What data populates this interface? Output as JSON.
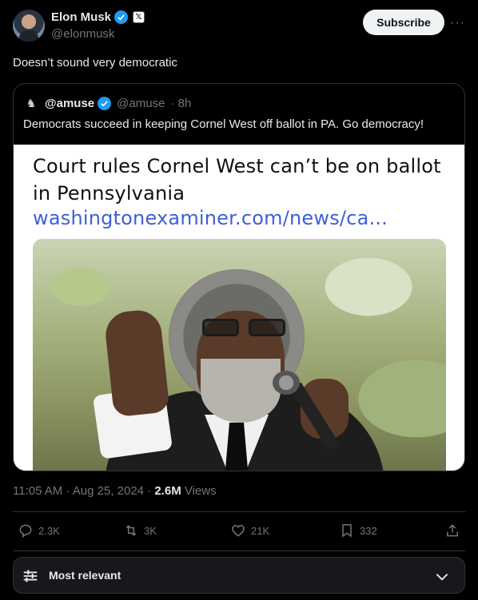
{
  "author": {
    "name": "Elon Musk",
    "handle": "@elonmusk",
    "badge": "𝕏"
  },
  "subscribe_label": "Subscribe",
  "more_label": "···",
  "tweet_text": "Doesn’t sound very democratic",
  "quote": {
    "name": "@amuse",
    "handle": "@amuse",
    "time": "· 8h",
    "text": "Democrats succeed in keeping Cornel West off ballot in PA. Go democracy!",
    "card": {
      "title": "Court rules Cornel West can’t be on ballot in Pennsylvania",
      "link": "washingtonexaminer.com/news/ca..."
    }
  },
  "meta": {
    "time": "11:05 AM · Aug 25, 2024 · ",
    "views_count": "2.6M",
    "views_label": " Views"
  },
  "actions": {
    "replies": "2.3K",
    "reposts": "3K",
    "likes": "21K",
    "bookmarks": "332"
  },
  "sort": {
    "label": "Most relevant"
  },
  "colors": {
    "background": "#000000",
    "verified": "#1d9bf0",
    "link": "#3f5fd6",
    "muted": "#71767b"
  }
}
